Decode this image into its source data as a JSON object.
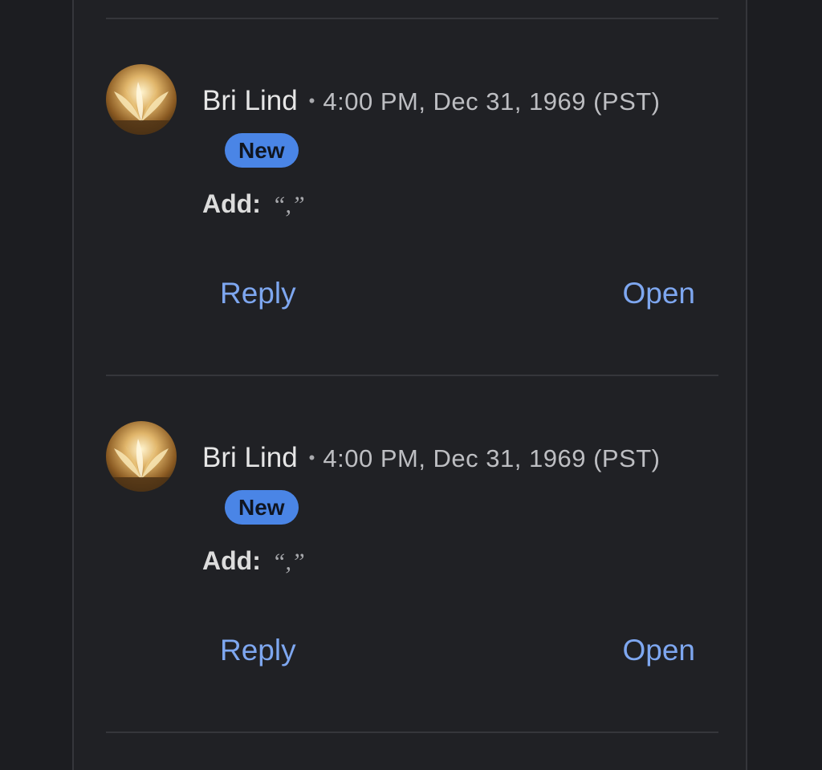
{
  "comments": [
    {
      "author": "Bri Lind",
      "separator": "•",
      "timestamp": "4:00 PM, Dec 31, 1969 (PST)",
      "badge": "New",
      "body_label": "Add:",
      "body_value": "“,”",
      "reply_label": "Reply",
      "open_label": "Open"
    },
    {
      "author": "Bri Lind",
      "separator": "•",
      "timestamp": "4:00 PM, Dec 31, 1969 (PST)",
      "badge": "New",
      "body_label": "Add:",
      "body_value": "“,”",
      "reply_label": "Reply",
      "open_label": "Open"
    }
  ],
  "colors": {
    "page_background": "#1c1d21",
    "panel_background": "#202125",
    "badge_background": "#4a85e6",
    "action_link": "#7ea7f0"
  }
}
